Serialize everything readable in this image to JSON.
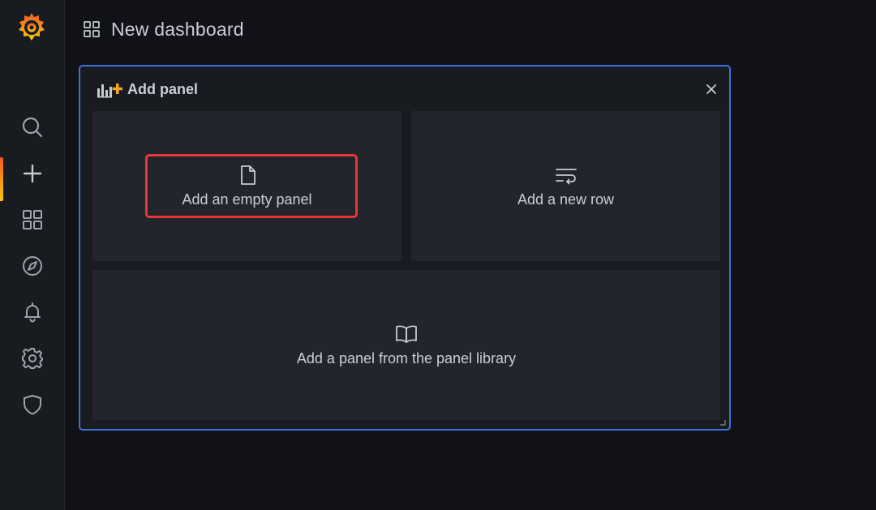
{
  "header": {
    "title": "New dashboard"
  },
  "sidebar": {
    "items": [
      {
        "id": "search",
        "icon": "search-icon"
      },
      {
        "id": "create",
        "icon": "plus-icon",
        "active": true
      },
      {
        "id": "dashboards",
        "icon": "apps-icon"
      },
      {
        "id": "explore",
        "icon": "compass-icon"
      },
      {
        "id": "alerting",
        "icon": "bell-icon"
      },
      {
        "id": "configuration",
        "icon": "gear-icon"
      },
      {
        "id": "server-admin",
        "icon": "shield-icon"
      }
    ]
  },
  "panel": {
    "title": "Add panel",
    "options": {
      "empty": {
        "label": "Add an empty panel",
        "icon": "file-icon"
      },
      "row": {
        "label": "Add a new row",
        "icon": "wrap-text-icon"
      },
      "library": {
        "label": "Add a panel from the panel library",
        "icon": "book-open-icon"
      }
    }
  },
  "colors": {
    "background": "#111217",
    "sidebar": "#181b1f",
    "panel_border": "#3d71d9",
    "highlight": "#e53935",
    "accent_gradient": [
      "#f05a28",
      "#fbca0a"
    ]
  }
}
